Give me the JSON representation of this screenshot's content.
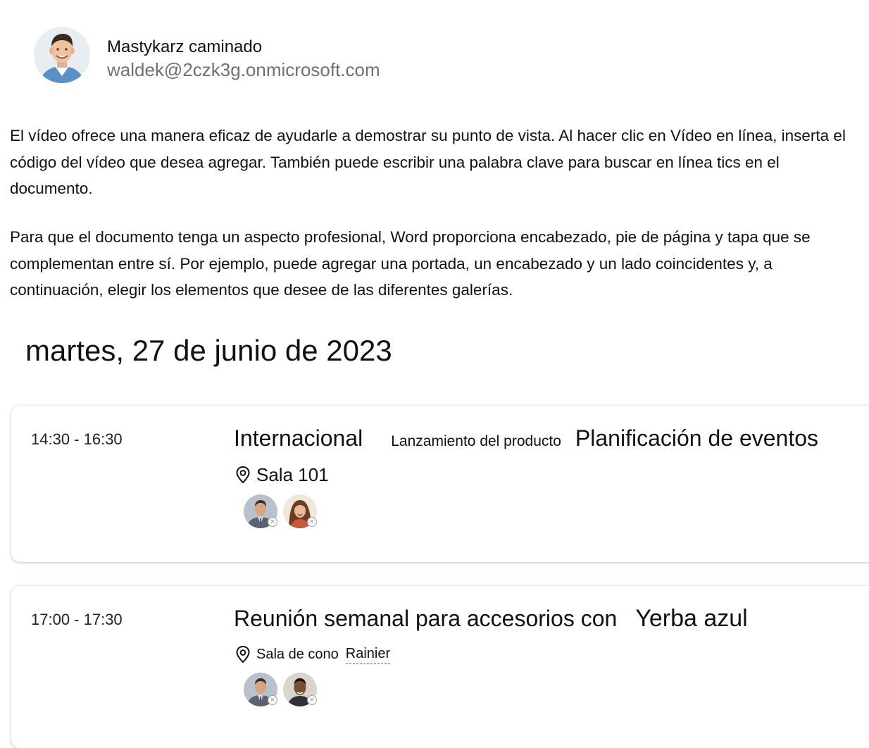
{
  "profile": {
    "name": "Mastykarz caminado",
    "email": "waldek@2czk3g.onmicrosoft.com"
  },
  "paragraphs": [
    "El vídeo ofrece una manera eficaz de ayudarle a demostrar su punto de vista. Al hacer clic en Vídeo en línea, inserta el código del vídeo que desea agregar. También puede escribir una palabra clave para buscar en línea tics en el documento.",
    "Para que el documento tenga un aspecto profesional, Word proporciona encabezado, pie de página y tapa que se complementan entre sí. Por ejemplo, puede agregar una portada, un encabezado y un lado coincidentes y, a continuación, elegir los elementos que desee de las diferentes galerías."
  ],
  "date_heading": "martes, 27 de junio de 2023",
  "events": [
    {
      "time": "14:30 - 16:30",
      "title_main": "Internacional",
      "title_small": "Lanzamiento del producto",
      "title_large": "Planificación de eventos",
      "location": "Sala 101",
      "attendee_status_icon": "×"
    },
    {
      "time": "17:00 - 17:30",
      "title_main": "Reunión semanal para accesorios con",
      "title_large": "Yerba azul",
      "location": "Sala de cono",
      "location_link": "Rainier",
      "attendee_status_icon": "×"
    }
  ],
  "icons": {
    "location": "location-pin-icon",
    "attendee_status": "declined-status-icon"
  },
  "colors": {
    "text": "#111111",
    "email": "#707070",
    "card_shadow": "#d0d0d0"
  }
}
